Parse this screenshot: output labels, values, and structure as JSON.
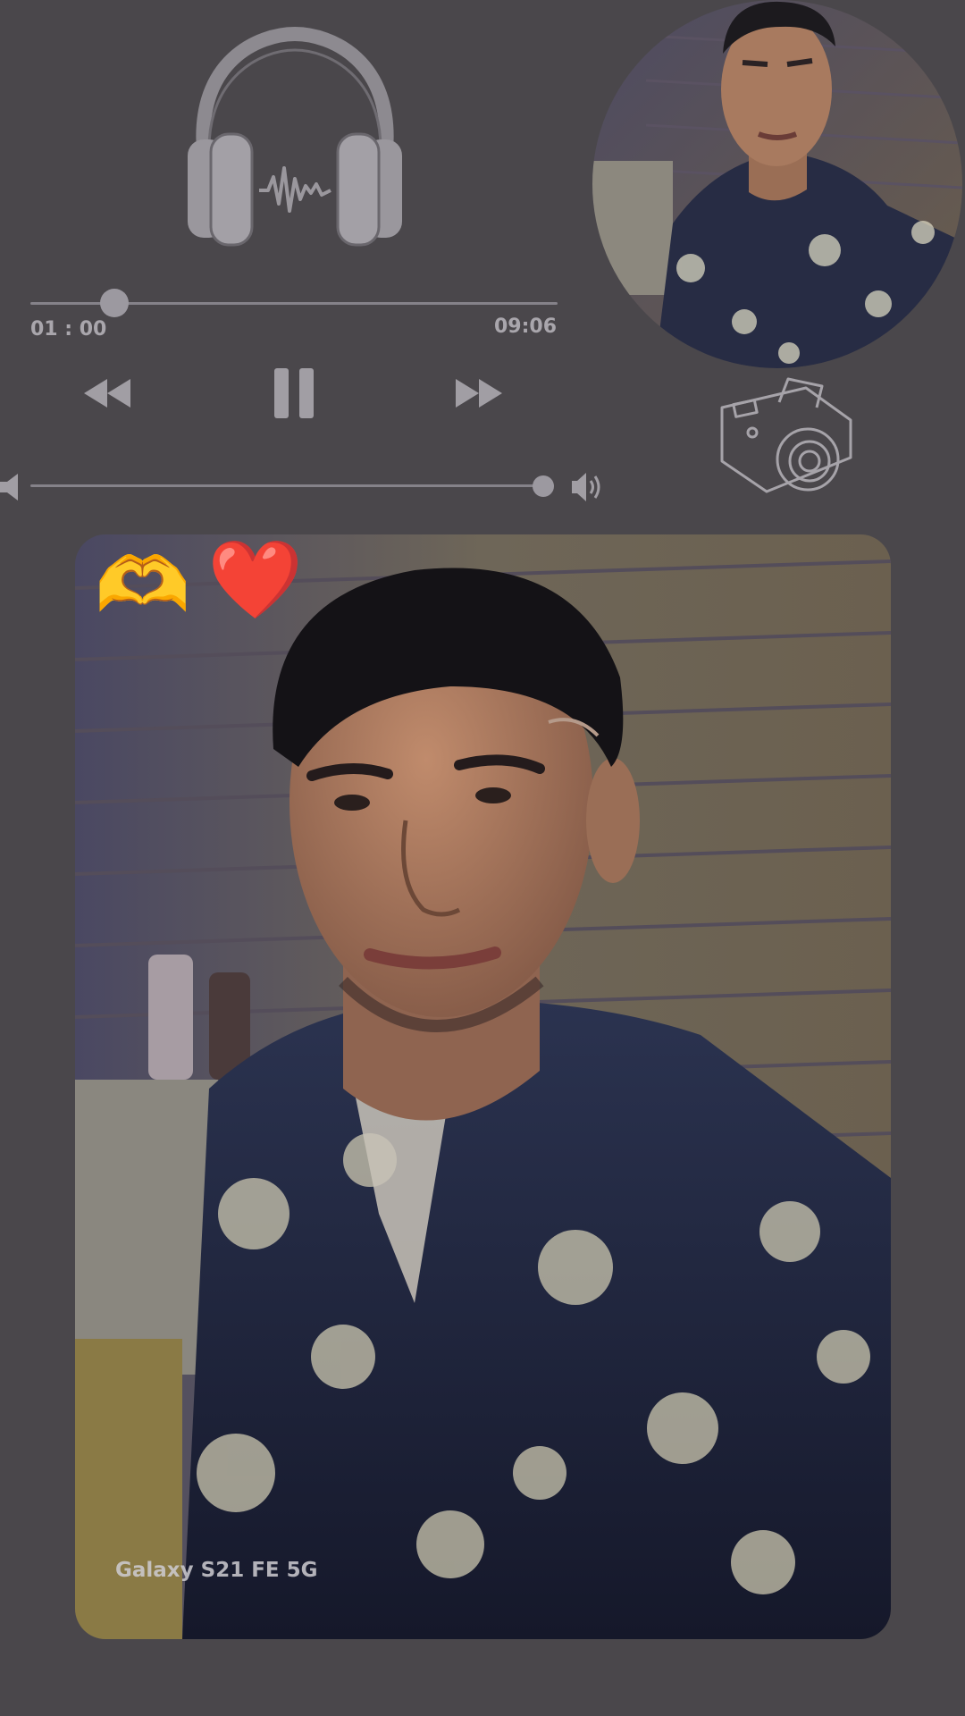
{
  "player": {
    "title": "",
    "elapsed": "01 : 00",
    "duration": "09:06",
    "progress": 0.16,
    "volume": 0.98
  },
  "photo": {
    "emoji_hands": "🫶",
    "emoji_heart": "❤️",
    "device_watermark": "Galaxy S21 FE 5G"
  },
  "icons": {
    "headphones": "headphones-icon",
    "rewind": "rewind-icon",
    "pause": "pause-icon",
    "fast_forward": "fast-forward-icon",
    "volume_low": "volume-low-icon",
    "volume_high": "volume-high-icon",
    "camera": "camera-icon"
  },
  "colors": {
    "background": "#4a474b",
    "control": "#9c99a0"
  }
}
